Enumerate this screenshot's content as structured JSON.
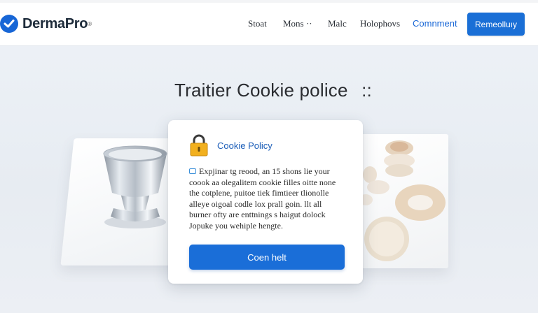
{
  "header": {
    "brand": "DermaPro",
    "brand_mark": "®",
    "nav": [
      {
        "label": "Stoat",
        "link": false
      },
      {
        "label": "Mons  ··",
        "link": false
      },
      {
        "label": "Malc",
        "link": false
      },
      {
        "label": "Holophovs",
        "link": false
      },
      {
        "label": "Comnment",
        "link": true
      }
    ],
    "cta_label": "Remeolluıy",
    "accent_color": "#1a6fd6"
  },
  "hero": {
    "title": "Traitier Cookie police",
    "title_suffix": "::"
  },
  "cookie_card": {
    "icon": "lock-icon",
    "title": "Cookie Policy",
    "body_icon": "link-icon",
    "body_lines": [
      "Expjinar tg reood, an 15 shons lie your",
      "coook aa olegalitem cookie filles oitte none",
      "the cotplene, puitoe tiek fimtieer tlionolle",
      "alleye oigoal codle lox prall goin. llt all",
      "burner ofty are enttnings s haigut dolock",
      "Jopuke you wehiple hengte."
    ],
    "button_label": "Coen helt"
  }
}
